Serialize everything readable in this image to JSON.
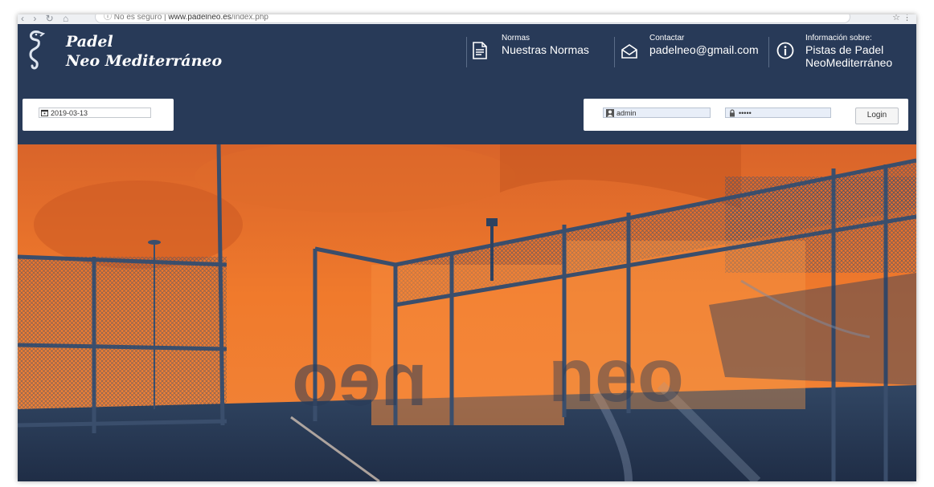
{
  "browser": {
    "nav_glyphs": "‹ › ↻ ⌂",
    "security_text": "ⓘ No es seguro",
    "url_host": "www.padelneo.es",
    "url_path": "/index.php",
    "menu_glyphs": "☆ ⋮"
  },
  "brand": {
    "line1": "Padel",
    "line2": "Neo Mediterráneo",
    "icon": "seahorse-icon"
  },
  "header": {
    "normas": {
      "small": "Normas",
      "big": "Nuestras Normas",
      "icon": "document-icon"
    },
    "contactar": {
      "small": "Contactar",
      "big": "padelneo@gmail.com",
      "icon": "envelope-icon"
    },
    "info": {
      "small": "Información sobre:",
      "big_line1": "Pistas de Padel",
      "big_line2": "NeoMediterráneo",
      "icon": "info-icon"
    }
  },
  "toolbar": {
    "date_value": "2019-03-13",
    "username_value": "admin",
    "password_value": "•••••",
    "login_label": "Login"
  },
  "hero": {
    "sign_left": "neo",
    "sign_right": "neo"
  },
  "colors": {
    "navy": "#283a58",
    "orange": "#f07a2c",
    "dark_orange": "#c8561c"
  }
}
